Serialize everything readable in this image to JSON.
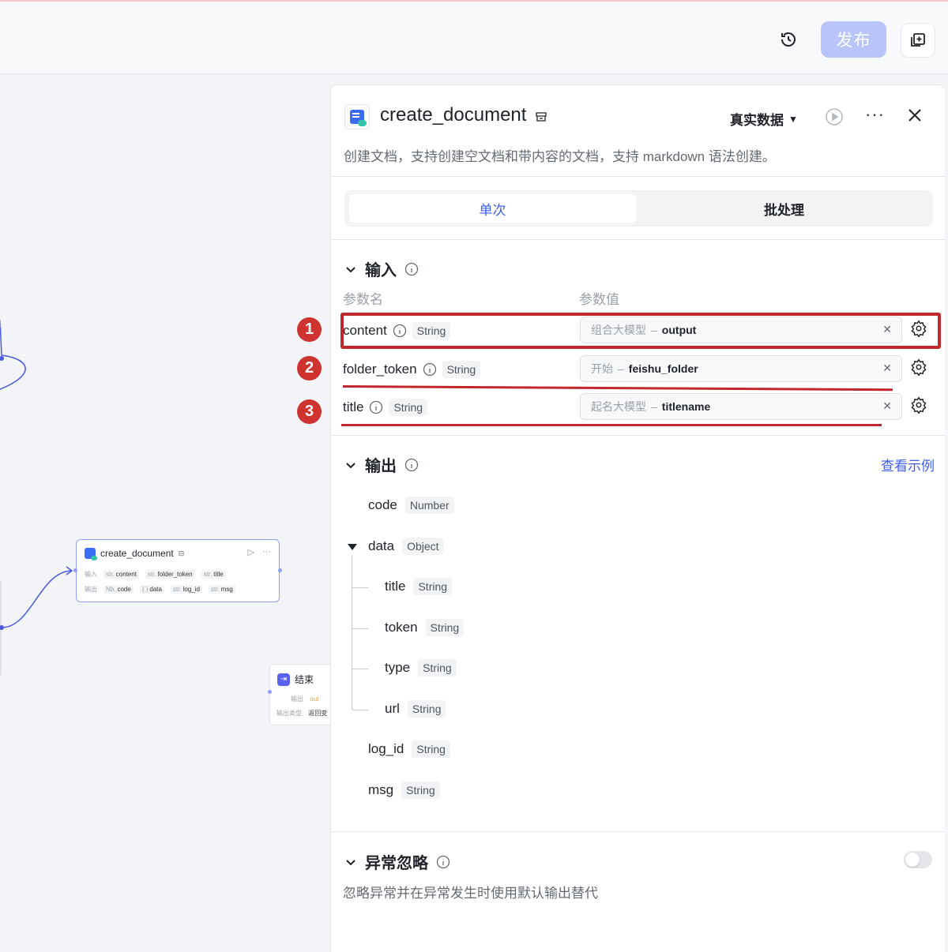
{
  "topbar": {
    "publish_label": "发布"
  },
  "canvas": {
    "node": {
      "title": "create_document",
      "input_label": "输入",
      "output_label": "输出",
      "inputs": [
        {
          "type": "str.",
          "name": "content"
        },
        {
          "type": "str.",
          "name": "folder_token"
        },
        {
          "type": "str.",
          "name": "title"
        }
      ],
      "outputs": [
        {
          "type": "Nb.",
          "name": "code"
        },
        {
          "type": "{ }",
          "name": "data"
        },
        {
          "type": "str.",
          "name": "log_id"
        },
        {
          "type": "str.",
          "name": "msg"
        }
      ]
    },
    "end_node": {
      "title": "结束",
      "output_label": "输出",
      "output_value": "out",
      "output_type_label": "输出类型",
      "output_type_value": "返回变"
    }
  },
  "panel": {
    "title": "create_document",
    "data_mode": "真实数据",
    "more": "···",
    "description": "创建文档，支持创建空文档和带内容的文档，支持 markdown 语法创建。",
    "tabs": [
      {
        "label": "单次",
        "active": true
      },
      {
        "label": "批处理",
        "active": false
      }
    ],
    "input_section": {
      "title": "输入",
      "col_name": "参数名",
      "col_value": "参数值",
      "params": [
        {
          "name": "content",
          "type": "String",
          "source": "组合大模型",
          "sep": "–",
          "var": "output"
        },
        {
          "name": "folder_token",
          "type": "String",
          "source": "开始",
          "sep": "–",
          "var": "feishu_folder"
        },
        {
          "name": "title",
          "type": "String",
          "source": "起名大模型",
          "sep": "–",
          "var": "titlename"
        }
      ]
    },
    "output_section": {
      "title": "输出",
      "view_example": "查看示例",
      "fields": [
        {
          "name": "code",
          "type": "Number"
        },
        {
          "name": "data",
          "type": "Object"
        },
        {
          "name": "title",
          "type": "String"
        },
        {
          "name": "token",
          "type": "String"
        },
        {
          "name": "type",
          "type": "String"
        },
        {
          "name": "url",
          "type": "String"
        },
        {
          "name": "log_id",
          "type": "String"
        },
        {
          "name": "msg",
          "type": "String"
        }
      ]
    },
    "ignore_section": {
      "title": "异常忽略",
      "description": "忽略异常并在异常发生时使用默认输出替代",
      "enabled": false
    }
  },
  "annotations": [
    "1",
    "2",
    "3"
  ],
  "colors": {
    "accent": "#3b5cf6",
    "annotation_red": "#c0282d",
    "publish_bg": "#b9c4fa"
  }
}
